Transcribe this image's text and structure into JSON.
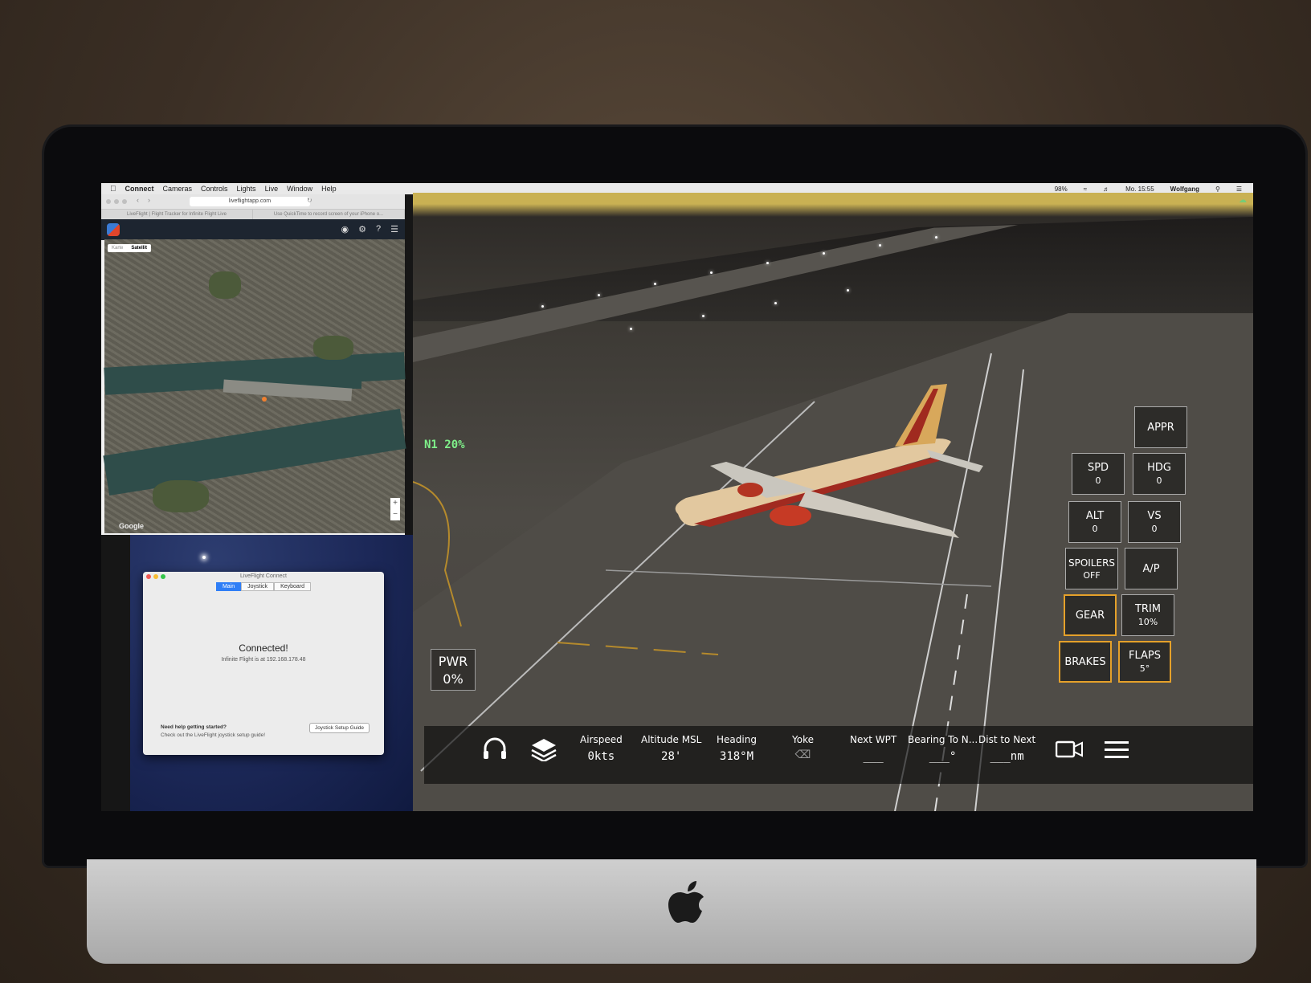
{
  "menubar": {
    "items": [
      "Connect",
      "Cameras",
      "Controls",
      "Lights",
      "Live",
      "Window",
      "Help"
    ],
    "status": {
      "battery": "98%",
      "clock": "Mo. 15:55",
      "user": "Wolfgang"
    }
  },
  "browser": {
    "url": "liveflightapp.com",
    "tabs": [
      "LiveFlight | Flight Tracker for Infinite Flight Live",
      "Use QuickTime to record screen of your iPhone o..."
    ],
    "map_toggle": [
      "Karte",
      "Satellit"
    ],
    "map_brand": "Google"
  },
  "connect_window": {
    "title": "LiveFlight Connect",
    "tabs": [
      "Main",
      "Joystick",
      "Keyboard"
    ],
    "status": "Connected!",
    "detail": "Infinite Flight is at 192.168.178.48",
    "help_title": "Need help getting started?",
    "help_text": "Check out the LiveFlight joystick setup guide!",
    "help_button": "Joystick Setup Guide"
  },
  "sim": {
    "n1": "N1  20%",
    "power": {
      "label": "PWR",
      "value": "0%"
    },
    "buttons": {
      "appr": {
        "label": "APPR"
      },
      "spd": {
        "label": "SPD",
        "value": "0"
      },
      "hdg": {
        "label": "HDG",
        "value": "0"
      },
      "alt": {
        "label": "ALT",
        "value": "0"
      },
      "vs": {
        "label": "VS",
        "value": "0"
      },
      "spoilers": {
        "label": "SPOILERS",
        "value": "OFF"
      },
      "ap": {
        "label": "A/P"
      },
      "gear": {
        "label": "GEAR"
      },
      "trim": {
        "label": "TRIM",
        "value": "10%"
      },
      "brakes": {
        "label": "BRAKES"
      },
      "flaps": {
        "label": "FLAPS",
        "value": "5°"
      }
    },
    "bottom": {
      "airspeed": {
        "label": "Airspeed",
        "value": "0kts"
      },
      "altitude": {
        "label": "Altitude MSL",
        "value": "28'"
      },
      "heading": {
        "label": "Heading",
        "value": "318°M"
      },
      "yoke": {
        "label": "Yoke"
      },
      "next_wpt": {
        "label": "Next WPT",
        "value": "___"
      },
      "bearing": {
        "label": "Bearing To N...",
        "value": "___°"
      },
      "dist": {
        "label": "Dist to Next",
        "value": "___nm"
      }
    }
  }
}
